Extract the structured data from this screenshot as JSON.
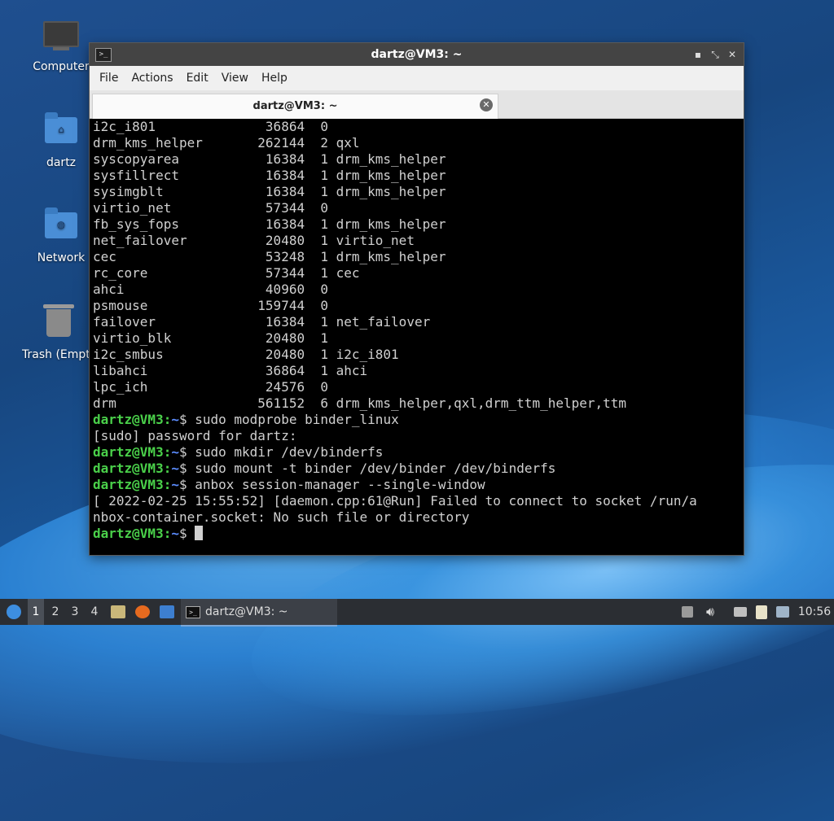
{
  "desktop": {
    "icons": [
      {
        "label": "Computer"
      },
      {
        "label": "dartz"
      },
      {
        "label": "Network"
      },
      {
        "label": "Trash (Empty)"
      }
    ]
  },
  "window": {
    "title": "dartz@VM3: ~",
    "menu": [
      "File",
      "Actions",
      "Edit",
      "View",
      "Help"
    ],
    "tab_title": "dartz@VM3: ~",
    "controls": {
      "minimize": "▪",
      "maximize": "⤡",
      "close": "✕"
    }
  },
  "terminal": {
    "lines": [
      {
        "text": "i2c_i801              36864  0"
      },
      {
        "text": "drm_kms_helper       262144  2 qxl"
      },
      {
        "text": "syscopyarea           16384  1 drm_kms_helper"
      },
      {
        "text": "sysfillrect           16384  1 drm_kms_helper"
      },
      {
        "text": "sysimgblt             16384  1 drm_kms_helper"
      },
      {
        "text": "virtio_net            57344  0"
      },
      {
        "text": "fb_sys_fops           16384  1 drm_kms_helper"
      },
      {
        "text": "net_failover          20480  1 virtio_net"
      },
      {
        "text": "cec                   53248  1 drm_kms_helper"
      },
      {
        "text": "rc_core               57344  1 cec"
      },
      {
        "text": "ahci                  40960  0"
      },
      {
        "text": "psmouse              159744  0"
      },
      {
        "text": "failover              16384  1 net_failover"
      },
      {
        "text": "virtio_blk            20480  1"
      },
      {
        "text": "i2c_smbus             20480  1 i2c_i801"
      },
      {
        "text": "libahci               36864  1 ahci"
      },
      {
        "text": "lpc_ich               24576  0"
      },
      {
        "text": "drm                  561152  6 drm_kms_helper,qxl,drm_ttm_helper,ttm"
      },
      {
        "user": "dartz@VM3",
        "path": "~",
        "cmd": "$ sudo modprobe binder_linux"
      },
      {
        "text": "[sudo] password for dartz:"
      },
      {
        "user": "dartz@VM3",
        "path": "~",
        "cmd": "$ sudo mkdir /dev/binderfs"
      },
      {
        "user": "dartz@VM3",
        "path": "~",
        "cmd": "$ sudo mount -t binder /dev/binder /dev/binderfs"
      },
      {
        "user": "dartz@VM3",
        "path": "~",
        "cmd": "$ anbox session-manager --single-window"
      },
      {
        "text": "[ 2022-02-25 15:55:52] [daemon.cpp:61@Run] Failed to connect to socket /run/a"
      },
      {
        "text": "nbox-container.socket: No such file or directory"
      },
      {
        "user": "dartz@VM3",
        "path": "~",
        "cmd": "$ ",
        "cursor": true
      }
    ]
  },
  "taskbar": {
    "workspaces": [
      "1",
      "2",
      "3",
      "4"
    ],
    "active_workspace": "1",
    "task_label": "dartz@VM3: ~",
    "clock": "10:56"
  }
}
